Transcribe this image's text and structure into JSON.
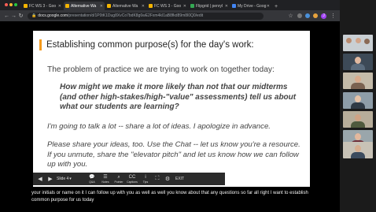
{
  "browser": {
    "tabs": [
      {
        "label": "FC WS 3 - Goo",
        "favicon_color": "#f4b400",
        "active": false
      },
      {
        "label": "Alternative Wa",
        "favicon_color": "#f4b400",
        "active": true
      },
      {
        "label": "Alternative Wa",
        "favicon_color": "#f4b400",
        "active": false
      },
      {
        "label": "FC WS 3 - Goo",
        "favicon_color": "#f4b400",
        "active": false
      },
      {
        "label": "Flipgrid | penryl",
        "favicon_color": "#34a853",
        "active": false
      },
      {
        "label": "My Drive - Goog",
        "favicon_color": "#4285f4",
        "active": false
      }
    ],
    "url_host": "docs.google.com",
    "url_path": "/presentation/d/1P0tK1Dug8XvCo7bdK8g6wE2Fxm4kI1aB8fkd89m8l0Q0/edit"
  },
  "slide": {
    "title": "Establishing common purpose(s) for the day's work:",
    "problem": "The problem of practice we are trying to work on together today:",
    "question": "How might we make it more likely than not that our midterms (and other high-stakes/high-\"value\" assessments) tell us about what our students are learning?",
    "talk": "I'm going to talk a lot -- share a lot of ideas. I apologize in advance.",
    "share": "Please share your ideas, too. Use the Chat -- let us know you're a resource. If you unmute, share the \"elevator pitch\" and let us know how we can follow up with you."
  },
  "controls": {
    "slide_label": "Slide 4",
    "items": [
      {
        "glyph": "💬",
        "label": "Q&A"
      },
      {
        "glyph": "☰",
        "label": "Notes"
      },
      {
        "glyph": "⌕",
        "label": "Pointer"
      },
      {
        "glyph": "CC",
        "label": "Captions"
      },
      {
        "glyph": "i",
        "label": "Tips"
      }
    ],
    "exit_label": "EXIT"
  },
  "caption": "your initials or name on it I can follow up with you as well as well you know about that any questions so far all right I want to establish common purpose for us today"
}
